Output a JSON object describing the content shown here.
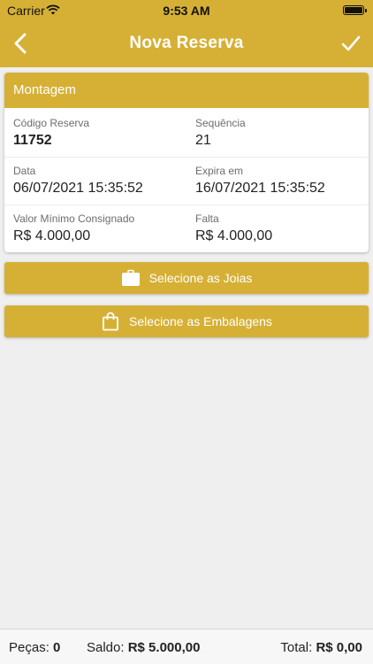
{
  "status_bar": {
    "carrier": "Carrier",
    "time": "9:53 AM"
  },
  "nav": {
    "title": "Nova Reserva",
    "back_icon": "chevron-left-icon",
    "confirm_icon": "check-icon"
  },
  "card": {
    "header": "Montagem",
    "fields": {
      "codigo_label": "Código Reserva",
      "codigo_value": "11752",
      "sequencia_label": "Sequência",
      "sequencia_value": "21",
      "data_label": "Data",
      "data_value": "06/07/2021 15:35:52",
      "expira_label": "Expira em",
      "expira_value": "16/07/2021 15:35:52",
      "valor_label": "Valor Mínimo Consignado",
      "valor_value": "R$ 4.000,00",
      "falta_label": "Falta",
      "falta_value": "R$ 4.000,00"
    }
  },
  "buttons": {
    "joias_label": "Selecione as Joias",
    "joias_icon": "briefcase-icon",
    "embalagens_label": "Selecione as Embalagens",
    "embalagens_icon": "shopping-bag-icon"
  },
  "footer": {
    "pecas_label": "Peças:",
    "pecas_value": "0",
    "saldo_label": "Saldo:",
    "saldo_value": "R$ 5.000,00",
    "total_label": "Total:",
    "total_value": "R$ 0,00"
  },
  "colors": {
    "accent": "#d6b035",
    "background": "#efefef"
  }
}
